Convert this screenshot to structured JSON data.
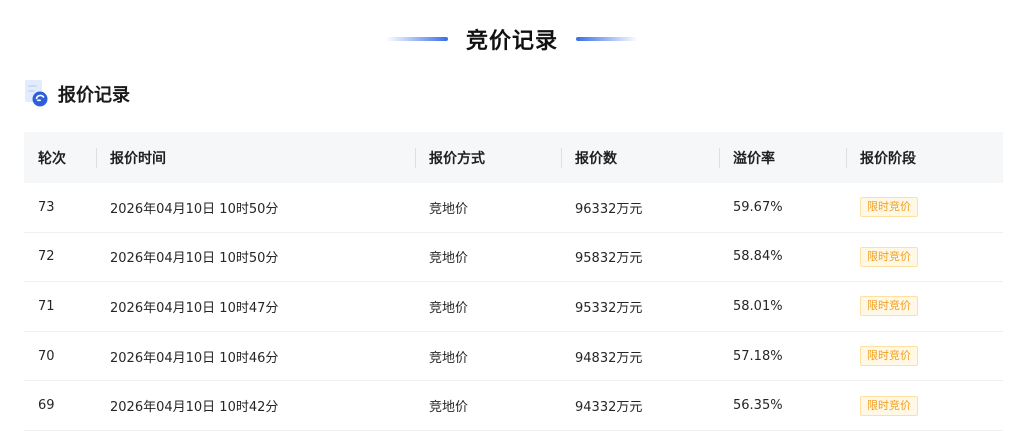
{
  "page": {
    "title": "竞价记录",
    "accent_color": "#3a6ee8"
  },
  "section": {
    "title": "报价记录",
    "icon": "document-record-icon"
  },
  "table": {
    "headers": [
      "轮次",
      "报价时间",
      "报价方式",
      "报价数",
      "溢价率",
      "报价阶段"
    ],
    "rows": [
      {
        "round": "73",
        "time": "2026年04月10日 10时50分",
        "method": "竞地价",
        "amount": "96332万元",
        "premium": "59.67%",
        "stage": "限时竞价"
      },
      {
        "round": "72",
        "time": "2026年04月10日 10时50分",
        "method": "竞地价",
        "amount": "95832万元",
        "premium": "58.84%",
        "stage": "限时竞价"
      },
      {
        "round": "71",
        "time": "2026年04月10日 10时47分",
        "method": "竞地价",
        "amount": "95332万元",
        "premium": "58.01%",
        "stage": "限时竞价"
      },
      {
        "round": "70",
        "time": "2026年04月10日 10时46分",
        "method": "竞地价",
        "amount": "94832万元",
        "premium": "57.18%",
        "stage": "限时竞价"
      },
      {
        "round": "69",
        "time": "2026年04月10日 10时42分",
        "method": "竞地价",
        "amount": "94332万元",
        "premium": "56.35%",
        "stage": "限时竞价"
      }
    ],
    "stage_badge_color": "#f0a020"
  }
}
